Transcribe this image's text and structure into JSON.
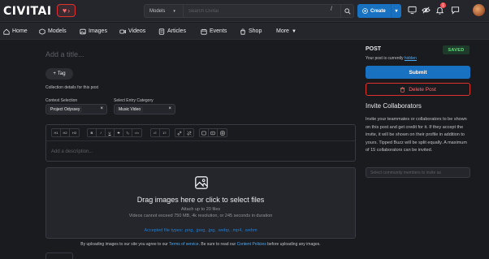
{
  "header": {
    "logo_main": "CIVIT",
    "logo_ai": "AI",
    "search_select": "Models",
    "search_placeholder": "Search Civitai",
    "search_shortcut": "/",
    "create_label": "Create",
    "notifications_count": "1"
  },
  "nav": {
    "items": [
      {
        "label": "Home",
        "icon": "home-icon"
      },
      {
        "label": "Models",
        "icon": "models-icon"
      },
      {
        "label": "Images",
        "icon": "images-icon"
      },
      {
        "label": "Videos",
        "icon": "videos-icon"
      },
      {
        "label": "Articles",
        "icon": "articles-icon"
      },
      {
        "label": "Events",
        "icon": "events-icon"
      },
      {
        "label": "Shop",
        "icon": "shop-icon"
      },
      {
        "label": "More",
        "icon": "chevron-down-icon"
      }
    ]
  },
  "post": {
    "title_placeholder": "Add a title...",
    "tag_label": "Tag",
    "collection_note": "Collection details for this post",
    "contest_label": "Contest Selection",
    "contest_value": "Project Odyssey",
    "category_label": "Select Entry Category",
    "category_value": "Music Video",
    "editor_placeholder": "Add a description...",
    "toolbar": {
      "headings": [
        "H1",
        "H2",
        "H3"
      ],
      "format": [
        "B",
        "I",
        "U",
        "S",
        "Tₓ",
        "</>"
      ],
      "lists": [
        "•≡",
        "1≡"
      ],
      "links": [
        "🔗",
        "⛓"
      ],
      "media": [
        "▣",
        "▶",
        "◎"
      ]
    }
  },
  "dropzone": {
    "title": "Drag images here or click to select files",
    "line1": "Attach up to 20 files",
    "line2": "Videos cannot exceed 750 MB, 4k resolution, or 245 seconds in duration",
    "accepted": "Accepted file types: .png, .jpeg, .jpg, .webp, .mp4, .webm"
  },
  "terms": {
    "prefix": "By uploading images to our site you agree to our",
    "tos": "Terms of service",
    "middle": ". Be sure to read our",
    "policies": "Content Policies",
    "suffix": "before uploading any images."
  },
  "sidebar": {
    "post_label": "POST",
    "saved_badge": "SAVED",
    "status_prefix": "Your post is currently",
    "status_value": "hidden",
    "submit_label": "Submit",
    "delete_label": "Delete Post",
    "invite_title": "Invite Collaborators",
    "invite_desc": "Invite your teammates or collaborators to be shown on this post and get credit for it. If they accept the invite, it will be shown on their profile in addition to yours. Tipped Buzz will be split equally. A maximum of 15 collaborators can be invited.",
    "invite_placeholder": "Select community members to invite as"
  },
  "colors": {
    "accent": "#1971c2",
    "danger": "#e03131",
    "success": "#69db7c",
    "background": "#1a1b1e"
  }
}
